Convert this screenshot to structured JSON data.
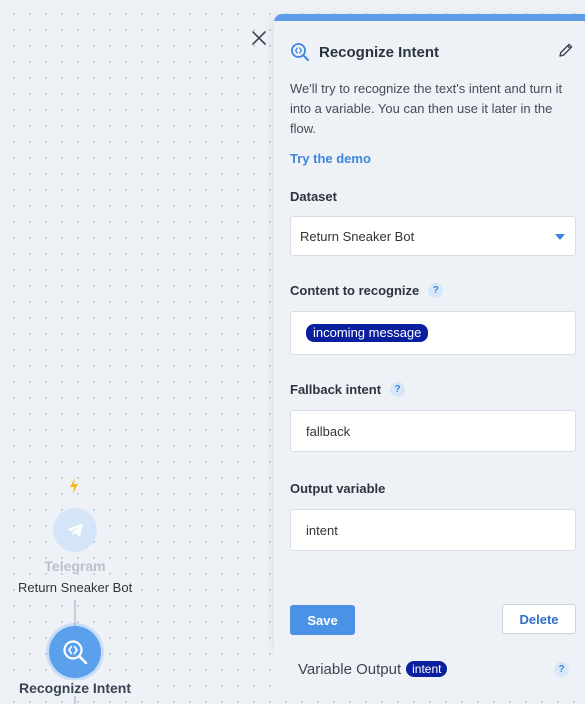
{
  "canvas": {
    "bolt_icon": "lightning-bolt",
    "telegram_node": {
      "title": "Telegram",
      "subtitle": "Return Sneaker Bot",
      "icon": "telegram-plane-icon"
    },
    "recognize_node": {
      "title": "Recognize Intent",
      "icon": "recognize-intent-icon"
    }
  },
  "panel": {
    "title": "Recognize Intent",
    "description": "We'll try to recognize the text's intent and turn it into a variable. You can then use it later in the flow.",
    "demo_link": "Try the demo",
    "dataset": {
      "label": "Dataset",
      "value": "Return Sneaker Bot"
    },
    "content": {
      "label": "Content to recognize",
      "help": "?",
      "tag": "incoming message"
    },
    "fallback": {
      "label": "Fallback intent",
      "help": "?",
      "value": "fallback"
    },
    "output": {
      "label": "Output variable",
      "value": "intent"
    },
    "save_label": "Save",
    "delete_label": "Delete"
  },
  "variable_output": {
    "label": "Variable Output",
    "tag": "intent",
    "help": "?"
  },
  "colors": {
    "accent": "#3a86de",
    "pill": "#0a1f9e",
    "canvas": "#eef2f7"
  }
}
